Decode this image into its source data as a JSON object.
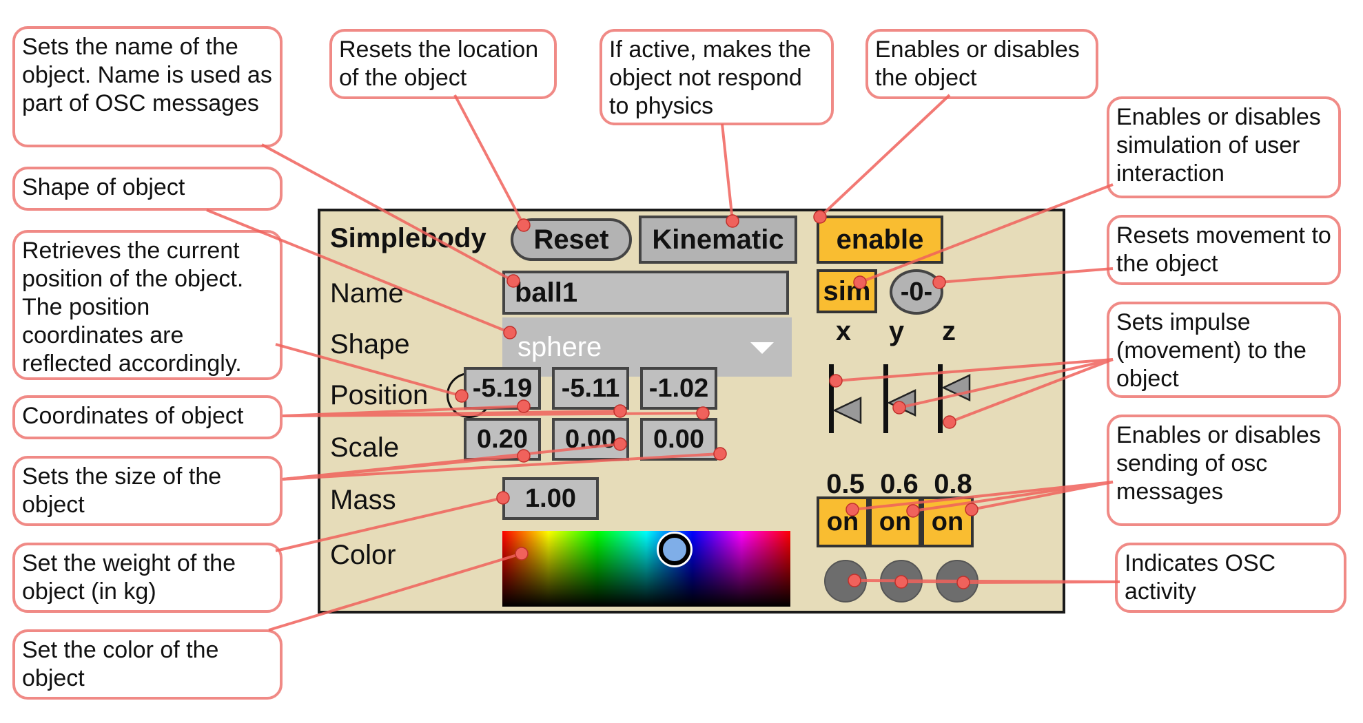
{
  "callouts": {
    "name": "Sets the name of the object. Name is used as part of OSC messages",
    "shape": "Shape of object",
    "position": "Retrieves the current position of the object. The position coordinates are reflected accordingly.",
    "coordinates": "Coordinates of object",
    "scale": "Sets the size of the object",
    "mass": "Set the weight of the object (in kg)",
    "color": "Set the color of the object",
    "reset": "Resets the location of the object",
    "kinematic": "If active, makes the object not respond to physics",
    "enable": "Enables or disables the object",
    "sim": "Enables or disables simulation of user interaction",
    "zero": "Resets movement to the object",
    "impulse": "Sets impulse (movement) to the object",
    "osc_send": "Enables or disables sending of osc messages",
    "osc_activity": "Indicates OSC activity"
  },
  "panel": {
    "title": "Simplebody",
    "reset_label": "Reset",
    "kinematic_label": "Kinematic",
    "enable_label": "enable",
    "sim_label": "sim",
    "zero_label": "-0-",
    "name_label": "Name",
    "name_value": "ball1",
    "shape_label": "Shape",
    "shape_value": "sphere",
    "position_label": "Position",
    "position": [
      "-5.19",
      "-5.11",
      "-1.02"
    ],
    "scale_label": "Scale",
    "scale": [
      "0.20",
      "0.00",
      "0.00"
    ],
    "mass_label": "Mass",
    "mass": "1.00",
    "color_label": "Color",
    "axes": [
      "x",
      "y",
      "z"
    ],
    "impulse": [
      "0.5",
      "0.6",
      "0.8"
    ],
    "impulse_values": [
      0.5,
      0.6,
      0.8
    ],
    "osc": [
      "on",
      "on",
      "on"
    ]
  },
  "colors": {
    "callout_border": "#f08a86",
    "leader": "#f0625c",
    "panel_bg": "#e6dcb9",
    "toggle_on": "#f9bd31",
    "knob": "#7faee8"
  }
}
